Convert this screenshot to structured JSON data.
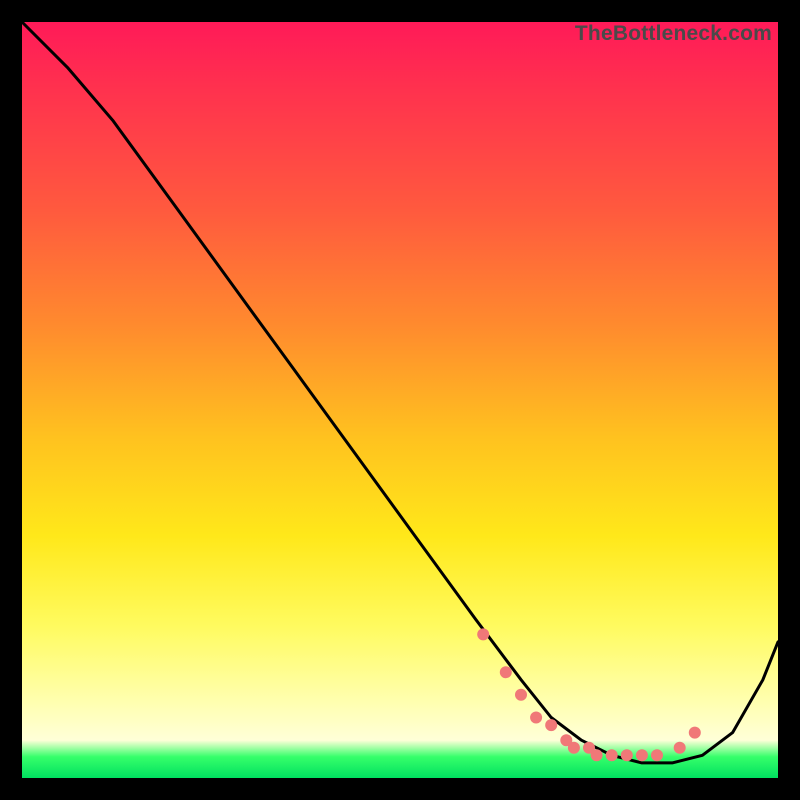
{
  "watermark": "TheBottleneck.com",
  "chart_data": {
    "type": "line",
    "title": "",
    "xlabel": "",
    "ylabel": "",
    "xlim": [
      0,
      100
    ],
    "ylim": [
      0,
      100
    ],
    "series": [
      {
        "name": "bottleneck-curve",
        "x": [
          0,
          6,
          12,
          20,
          28,
          36,
          44,
          52,
          60,
          66,
          70,
          74,
          78,
          82,
          86,
          90,
          94,
          98,
          100
        ],
        "y": [
          100,
          94,
          87,
          76,
          65,
          54,
          43,
          32,
          21,
          13,
          8,
          5,
          3,
          2,
          2,
          3,
          6,
          13,
          18
        ]
      }
    ],
    "markers": {
      "name": "highlight-dots",
      "x": [
        61,
        64,
        66,
        68,
        70,
        72,
        73,
        75,
        76,
        78,
        80,
        82,
        84,
        87,
        89
      ],
      "y": [
        19,
        14,
        11,
        8,
        7,
        5,
        4,
        4,
        3,
        3,
        3,
        3,
        3,
        4,
        6
      ]
    },
    "colors": {
      "line": "#000000",
      "marker": "#f07878"
    }
  }
}
